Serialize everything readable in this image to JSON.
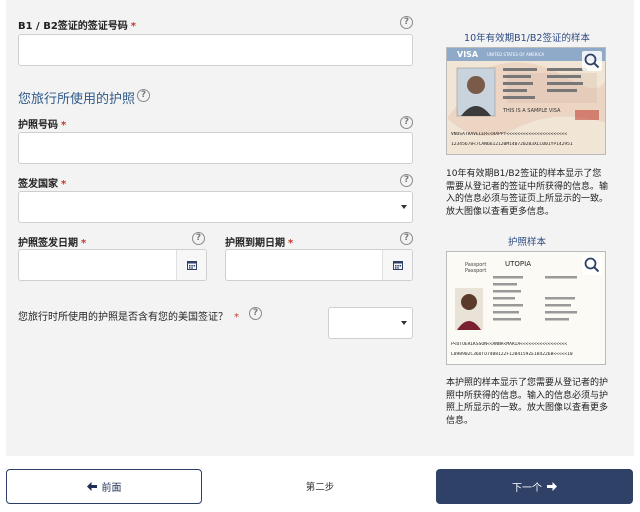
{
  "form": {
    "visa_number_label": "B1 / B2签证的签证号码",
    "visa_number_value": "",
    "passport_section_title": "您旅行所使用的护照",
    "passport_number_label": "护照号码",
    "passport_number_value": "",
    "issuing_country_label": "签发国家",
    "issuing_country_value": "",
    "issue_date_label": "护照签发日期",
    "issue_date_value": "",
    "expiry_date_label": "护照到期日期",
    "expiry_date_value": "",
    "visa_in_passport_question": "您旅行时所使用的护照是否含有您的美国签证？",
    "visa_in_passport_value": "",
    "required_mark": "*",
    "help_glyph": "?"
  },
  "sidebar": {
    "visa_sample_title": "10年有效期B1/B2签证的样本",
    "visa_sample_description": "10年有效期B1/B2签证的样本显示了您需要从登记者的签证中所获得的信息。输入的信息必须与签证页上所显示的一致。放大图像以查看更多信息。",
    "passport_sample_title": "护照样本",
    "passport_sample_description": "本护照的样本显示了您需要从登记者的护照中所获得的信息。输入的信息必须与护照上所显示的一致。放大图像以查看更多信息。",
    "visa_image": {
      "header": "VISA",
      "country": "UNITED STATES OF AMERICA",
      "annotation": "THIS IS A SAMPLE VISA",
      "mrz_line1": "VNUSATRAVELER<<HAPPY<<<<<<<<<<<<<<<<<<<<<<",
      "mrz_line2": "12345678<7CAN6612120M1407202B3XLC001YP142951"
    },
    "passport_image": {
      "header_line1": "Passport",
      "header_line2": "Passport",
      "country": "UTOPIA",
      "mrz_line1": "P<UTOERIKSSON<<ANNA<MARIA<<<<<<<<<<<<<<<<<",
      "mrz_line2": "L898902C36UTO7408122F1204159ZE184226B<<<<<10"
    }
  },
  "nav": {
    "back_label": "前面",
    "step_label": "第二步",
    "next_label": "下一个"
  },
  "colors": {
    "primary_dark": "#2f4167",
    "section_title": "#2f5a8a",
    "required": "#c0392b"
  }
}
